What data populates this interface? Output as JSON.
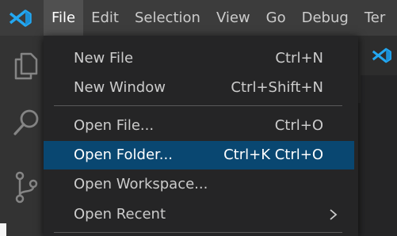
{
  "menubar": {
    "items": [
      {
        "label": "File"
      },
      {
        "label": "Edit"
      },
      {
        "label": "Selection"
      },
      {
        "label": "View"
      },
      {
        "label": "Go"
      },
      {
        "label": "Debug"
      },
      {
        "label": "Ter"
      }
    ]
  },
  "file_menu": {
    "items": [
      {
        "label": "New File",
        "shortcut": "Ctrl+N"
      },
      {
        "label": "New Window",
        "shortcut": "Ctrl+Shift+N"
      },
      {
        "label": "Open File...",
        "shortcut": "Ctrl+O"
      },
      {
        "label": "Open Folder...",
        "shortcut": "Ctrl+K Ctrl+O",
        "highlighted": true
      },
      {
        "label": "Open Workspace...",
        "shortcut": ""
      },
      {
        "label": "Open Recent",
        "shortcut": "",
        "submenu": true
      }
    ]
  },
  "activity_bar": {
    "icons": [
      "explorer-icon",
      "search-icon",
      "source-control-icon"
    ]
  },
  "colors": {
    "titlebar": "#3c3c3c",
    "activity_bar": "#333333",
    "menu_background": "#252526",
    "highlight": "#094771",
    "brand_blue": "#23a8f2"
  }
}
